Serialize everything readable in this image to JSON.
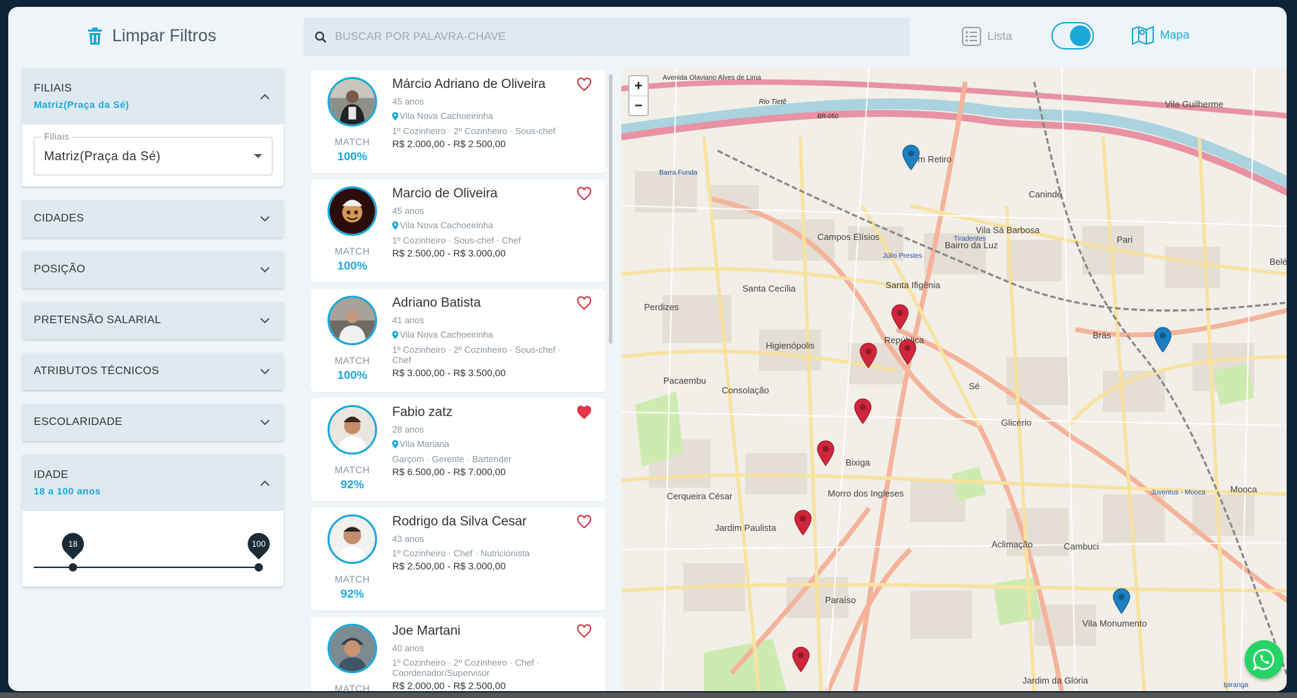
{
  "header": {
    "clear_filters": "Limpar Filtros",
    "search_placeholder": "BUSCAR POR PALAVRA-CHAVE",
    "view_list": "Lista",
    "view_map": "Mapa"
  },
  "filters": {
    "filiais": {
      "title": "FILIAIS",
      "selected": "Matriz(Praça da Sé)",
      "field_label": "Filiais",
      "field_value": "Matriz(Praça da Sé)"
    },
    "cidades": {
      "title": "CIDADES"
    },
    "posicao": {
      "title": "POSIÇÃO"
    },
    "pretensao": {
      "title": "PRETENSÃO SALARIAL"
    },
    "atributos": {
      "title": "ATRIBUTOS TÉCNICOS"
    },
    "escolaridade": {
      "title": "ESCOLARIDADE"
    },
    "idade": {
      "title": "IDADE",
      "selected": "18 a 100 anos",
      "min": "18",
      "max": "100"
    }
  },
  "candidates": [
    {
      "name": "Márcio Adriano de Oliveira",
      "age": "45 anos",
      "location": "Vila Nova Cachoeirinha",
      "roles": "1º Cozinheiro · 2º Cozinheiro · Sous-chef",
      "salary": "R$ 2.000,00 - R$ 2.500,00",
      "match_label": "MATCH",
      "match": "100%",
      "favorite": false
    },
    {
      "name": "Marcio de Oliveira",
      "age": "45 anos",
      "location": "Vila Nova Cachoeirinha",
      "roles": "1º Cozinheiro · Sous-chef · Chef",
      "salary": "R$ 2.500,00 - R$ 3.000,00",
      "match_label": "MATCH",
      "match": "100%",
      "favorite": false
    },
    {
      "name": "Adriano Batista",
      "age": "41 anos",
      "location": "Vila Nova Cachoeirinha",
      "roles": "1º Cozinheiro · 2º Cozinheiro · Sous-chef · Chef",
      "salary": "R$ 3.000,00 - R$ 3.500,00",
      "match_label": "MATCH",
      "match": "100%",
      "favorite": false
    },
    {
      "name": "Fabio zatz",
      "age": "28 anos",
      "location": "Vila Mariana",
      "roles": "Garçom · Gerente · Bartender",
      "salary": "R$ 6.500,00 - R$ 7.000,00",
      "match_label": "MATCH",
      "match": "92%",
      "favorite": true
    },
    {
      "name": "Rodrigo da Silva Cesar",
      "age": "43 anos",
      "location": "",
      "roles": "1º Cozinheiro · Chef · Nutricionista",
      "salary": "R$ 2.500,00 - R$ 3.000,00",
      "match_label": "MATCH",
      "match": "92%",
      "favorite": false
    },
    {
      "name": "Joe Martani",
      "age": "40 anos",
      "location": "",
      "roles": "1º Cozinheiro · 2º Cozinheiro · Chef · Coordenador/Supervisor",
      "salary": "R$ 2.000,00 - R$ 2.500,00",
      "match_label": "MATCH",
      "match": "",
      "favorite": false
    }
  ],
  "map": {
    "zoom_in": "+",
    "zoom_out": "−",
    "labels": [
      "Avenida Olaviano Alves de Lima",
      "Rio Tietê",
      "BR-050",
      "Vila Guilherme",
      "Bom Retiro",
      "Barra Funda",
      "Canindé",
      "Campos Elísios",
      "Vila Sá Barbosa",
      "Bairro da Luz",
      "Pari",
      "Belém",
      "Santa Cecília",
      "Santa Ifigênia",
      "Perdizes",
      "Higienópolis",
      "República",
      "Brás",
      "Pacaembu",
      "Consolação",
      "Sé",
      "Glicério",
      "Bixiga",
      "Cerqueira César",
      "Morro dos Ingleses",
      "Jardim Paulista",
      "Aclimação",
      "Cambuci",
      "Mooca",
      "Paraíso",
      "Vila Monumento",
      "Jardim da Glória",
      "Tiradentes",
      "Júlio Prestes",
      "Juventus - Mooca",
      "Ipiranga"
    ]
  },
  "colors": {
    "accent": "#1aa8d9",
    "pin_red": "#d0263b",
    "pin_blue": "#1c7fbf"
  }
}
